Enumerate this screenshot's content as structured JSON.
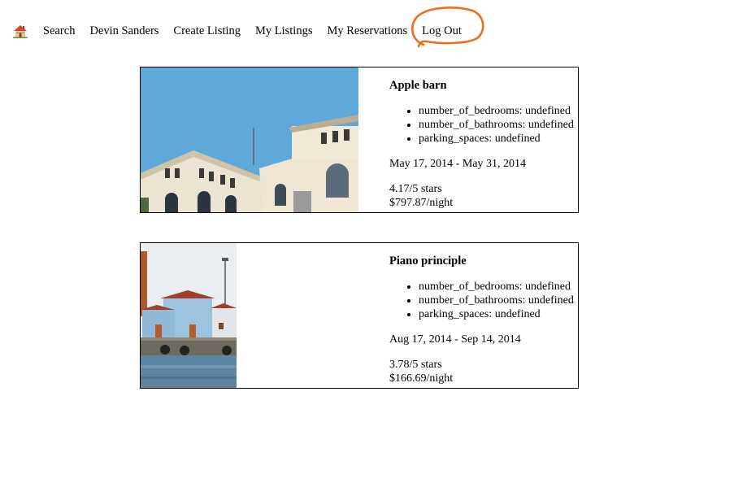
{
  "nav": {
    "home_icon": "house-icon",
    "items": [
      "Search",
      "Devin Sanders",
      "Create Listing",
      "My Listings",
      "My Reservations",
      "Log Out"
    ]
  },
  "annotation_color": "#f26a1b",
  "listings": [
    {
      "title": "Apple barn",
      "features": [
        "number_of_bedrooms: undefined",
        "number_of_bathrooms: undefined",
        "parking_spaces: undefined"
      ],
      "dates": "May 17, 2014 - May 31, 2014",
      "rating": "4.17/5 stars",
      "price": "$797.87/night"
    },
    {
      "title": "Piano principle",
      "features": [
        "number_of_bedrooms: undefined",
        "number_of_bathrooms: undefined",
        "parking_spaces: undefined"
      ],
      "dates": "Aug 17, 2014 - Sep 14, 2014",
      "rating": "3.78/5 stars",
      "price": "$166.69/night"
    }
  ]
}
